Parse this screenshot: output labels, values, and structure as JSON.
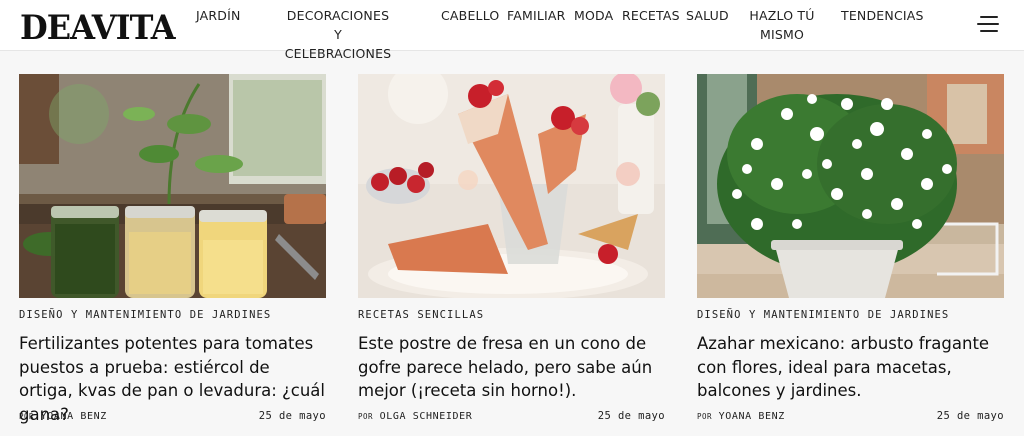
{
  "site": {
    "logo": "DEAVITA"
  },
  "nav": {
    "items": [
      {
        "label": "JARDÍN"
      },
      {
        "label": "DECORACIONES Y\nCELEBRACIONES"
      },
      {
        "label": "CABELLO"
      },
      {
        "label": "FAMILIAR"
      },
      {
        "label": "MODA"
      },
      {
        "label": "RECETAS"
      },
      {
        "label": "SALUD"
      },
      {
        "label": "HAZLO TÚ\nMISMO"
      },
      {
        "label": "TENDENCIAS"
      }
    ],
    "menu_icon": "hamburger-menu-icon"
  },
  "articles": [
    {
      "category": "DISEÑO Y MANTENIMIENTO DE JARDINES",
      "title": "Fertilizantes potentes para tomates puestos a prueba: estiércol de ortiga, kvas de pan o levadura: ¿cuál gana?",
      "by_prefix": "POR",
      "author": "YOANA BENZ",
      "date": "25 de mayo",
      "image": "tomato-plant-fertilizer-jars-photo"
    },
    {
      "category": "RECETAS SENCILLAS",
      "title": "Este postre de fresa en un cono de gofre parece helado, pero sabe aún mejor (¡receta sin horno!).",
      "by_prefix": "POR",
      "author": "OLGA SCHNEIDER",
      "date": "25 de mayo",
      "image": "strawberry-waffle-cone-dessert-photo"
    },
    {
      "category": "DISEÑO Y MANTENIMIENTO DE JARDINES",
      "title": "Azahar mexicano: arbusto fragante con flores, ideal para macetas, balcones y jardines.",
      "by_prefix": "POR",
      "author": "YOANA BENZ",
      "date": "25 de mayo",
      "image": "mexican-orange-blossom-pot-photo"
    }
  ]
}
